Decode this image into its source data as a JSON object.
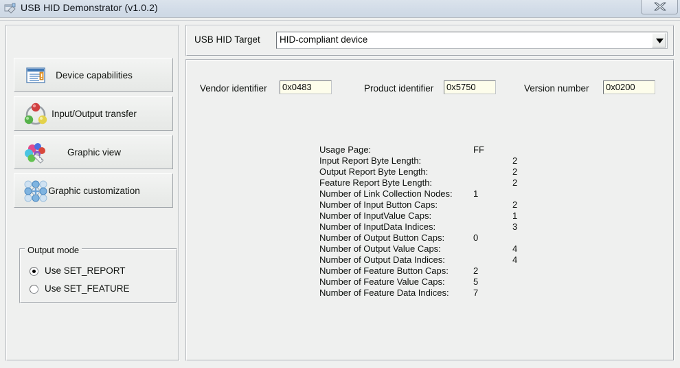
{
  "window": {
    "title": "USB HID Demonstrator (v1.0.2)",
    "app_icon": "app-icon",
    "close_label": "✕"
  },
  "sidebar": {
    "buttons": [
      {
        "label": "Device capabilities",
        "icon": "document-list-icon"
      },
      {
        "label": "Input/Output transfer",
        "icon": "three-spheres-icon"
      },
      {
        "label": "Graphic view",
        "icon": "color-palette-icon"
      },
      {
        "label": "Graphic customization",
        "icon": "node-grid-icon"
      }
    ],
    "output_mode": {
      "legend": "Output mode",
      "options": [
        {
          "label": "Use SET_REPORT",
          "selected": true
        },
        {
          "label": "Use SET_FEATURE",
          "selected": false
        }
      ]
    }
  },
  "target": {
    "label": "USB HID Target",
    "value": "HID-compliant device",
    "arrow_icon": "chevron-down-icon"
  },
  "identifiers": [
    {
      "label": "Vendor identifier",
      "value": "0x0483"
    },
    {
      "label": "Product identifier",
      "value": "0x5750"
    },
    {
      "label": "Version number",
      "value": "0x0200"
    }
  ],
  "capabilities": [
    {
      "name": "Usage Page:",
      "value": "FF",
      "column": "a"
    },
    {
      "name": "Input Report Byte Length:",
      "value": "2",
      "column": "b"
    },
    {
      "name": "Output Report Byte Length:",
      "value": "2",
      "column": "b"
    },
    {
      "name": "Feature Report Byte Length:",
      "value": "2",
      "column": "b"
    },
    {
      "name": "Number of Link Collection Nodes:",
      "value": "1",
      "column": "a"
    },
    {
      "name": "Number of Input Button Caps:",
      "value": "2",
      "column": "b"
    },
    {
      "name": "Number of InputValue Caps:",
      "value": "1",
      "column": "b"
    },
    {
      "name": "Number of InputData Indices:",
      "value": "3",
      "column": "b"
    },
    {
      "name": "Number of Output Button Caps:",
      "value": "0",
      "column": "a"
    },
    {
      "name": "Number of Output Value Caps:",
      "value": "4",
      "column": "b"
    },
    {
      "name": "Number of Output Data Indices:",
      "value": "4",
      "column": "b"
    },
    {
      "name": "Number of Feature Button Caps:",
      "value": "2",
      "column": "a"
    },
    {
      "name": "Number of Feature Value Caps:",
      "value": "5",
      "column": "a"
    },
    {
      "name": "Number of Feature Data Indices:",
      "value": "7",
      "column": "a"
    }
  ],
  "colors": {
    "window_bg": "#eff0ef",
    "titlebar": "#d2dce8",
    "field_bg": "#fdfdeb",
    "combo_bg": "#ffffff"
  }
}
